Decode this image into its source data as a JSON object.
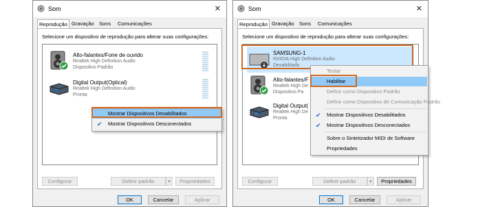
{
  "accent": "#d2691e",
  "left": {
    "title": "Som",
    "tabs": [
      "Reprodução",
      "Gravação",
      "Sons",
      "Comunicações"
    ],
    "prompt": "Selecione um dispositivo de reprodução para alterar suas configurações:",
    "devices": [
      {
        "name": "Alto-falantes/Fone de ouvido",
        "driver": "Realtek High Definition Audio",
        "status": "Dispositivo Padrão",
        "icon": "speaker-icon"
      },
      {
        "name": "Digital Output(Optical)",
        "driver": "Realtek High Definition Audio",
        "status": "Pronta",
        "icon": "optical-output-icon"
      }
    ],
    "menu": [
      {
        "label": "Mostrar Dispositivos Desabilitados",
        "checked": false
      },
      {
        "label": "Mostrar Dispositivos Desconectados",
        "checked": true
      }
    ],
    "buttons": {
      "configure": "Configurar",
      "default": "Definir padrão",
      "properties": "Propriedades",
      "ok": "OK",
      "cancel": "Cancelar",
      "apply": "Aplicar"
    }
  },
  "right": {
    "title": "Som",
    "tabs": [
      "Reprodução",
      "Gravação",
      "Sons",
      "Comunicações"
    ],
    "prompt": "Selecione um dispositivo de reprodução para alterar suas configurações:",
    "devices": [
      {
        "name": "SAMSUNG-1",
        "driver": "NVIDIA High Definition Audio",
        "status": "Desabilitado",
        "icon": "monitor-icon"
      },
      {
        "name": "Alto-falantes/F",
        "driver": "Realtek High De",
        "status": "Dispositivo Pa",
        "icon": "speaker-icon"
      },
      {
        "name": "Digital Output(",
        "driver": "Realtek High De",
        "status": "Pronta",
        "icon": "optical-output-icon"
      }
    ],
    "menu": {
      "test": "Testar",
      "enable": "Habilitar",
      "set_default": "Definir como Dispositivo Padrão",
      "set_comm_default": "Definir como Dispositivo de Comunicação Padrão",
      "show_disabled": "Mostrar Dispositivos Desabilitados",
      "show_disconnected": "Mostrar Dispositivos Desconectados",
      "about_midi": "Sobre o Sintetizador MIDI de Software",
      "properties": "Propriedades"
    },
    "buttons": {
      "configure": "Configurar",
      "default": "Definir padrão",
      "properties": "Propriedades",
      "ok": "OK",
      "cancel": "Cancelar",
      "apply": "Aplicar"
    }
  }
}
